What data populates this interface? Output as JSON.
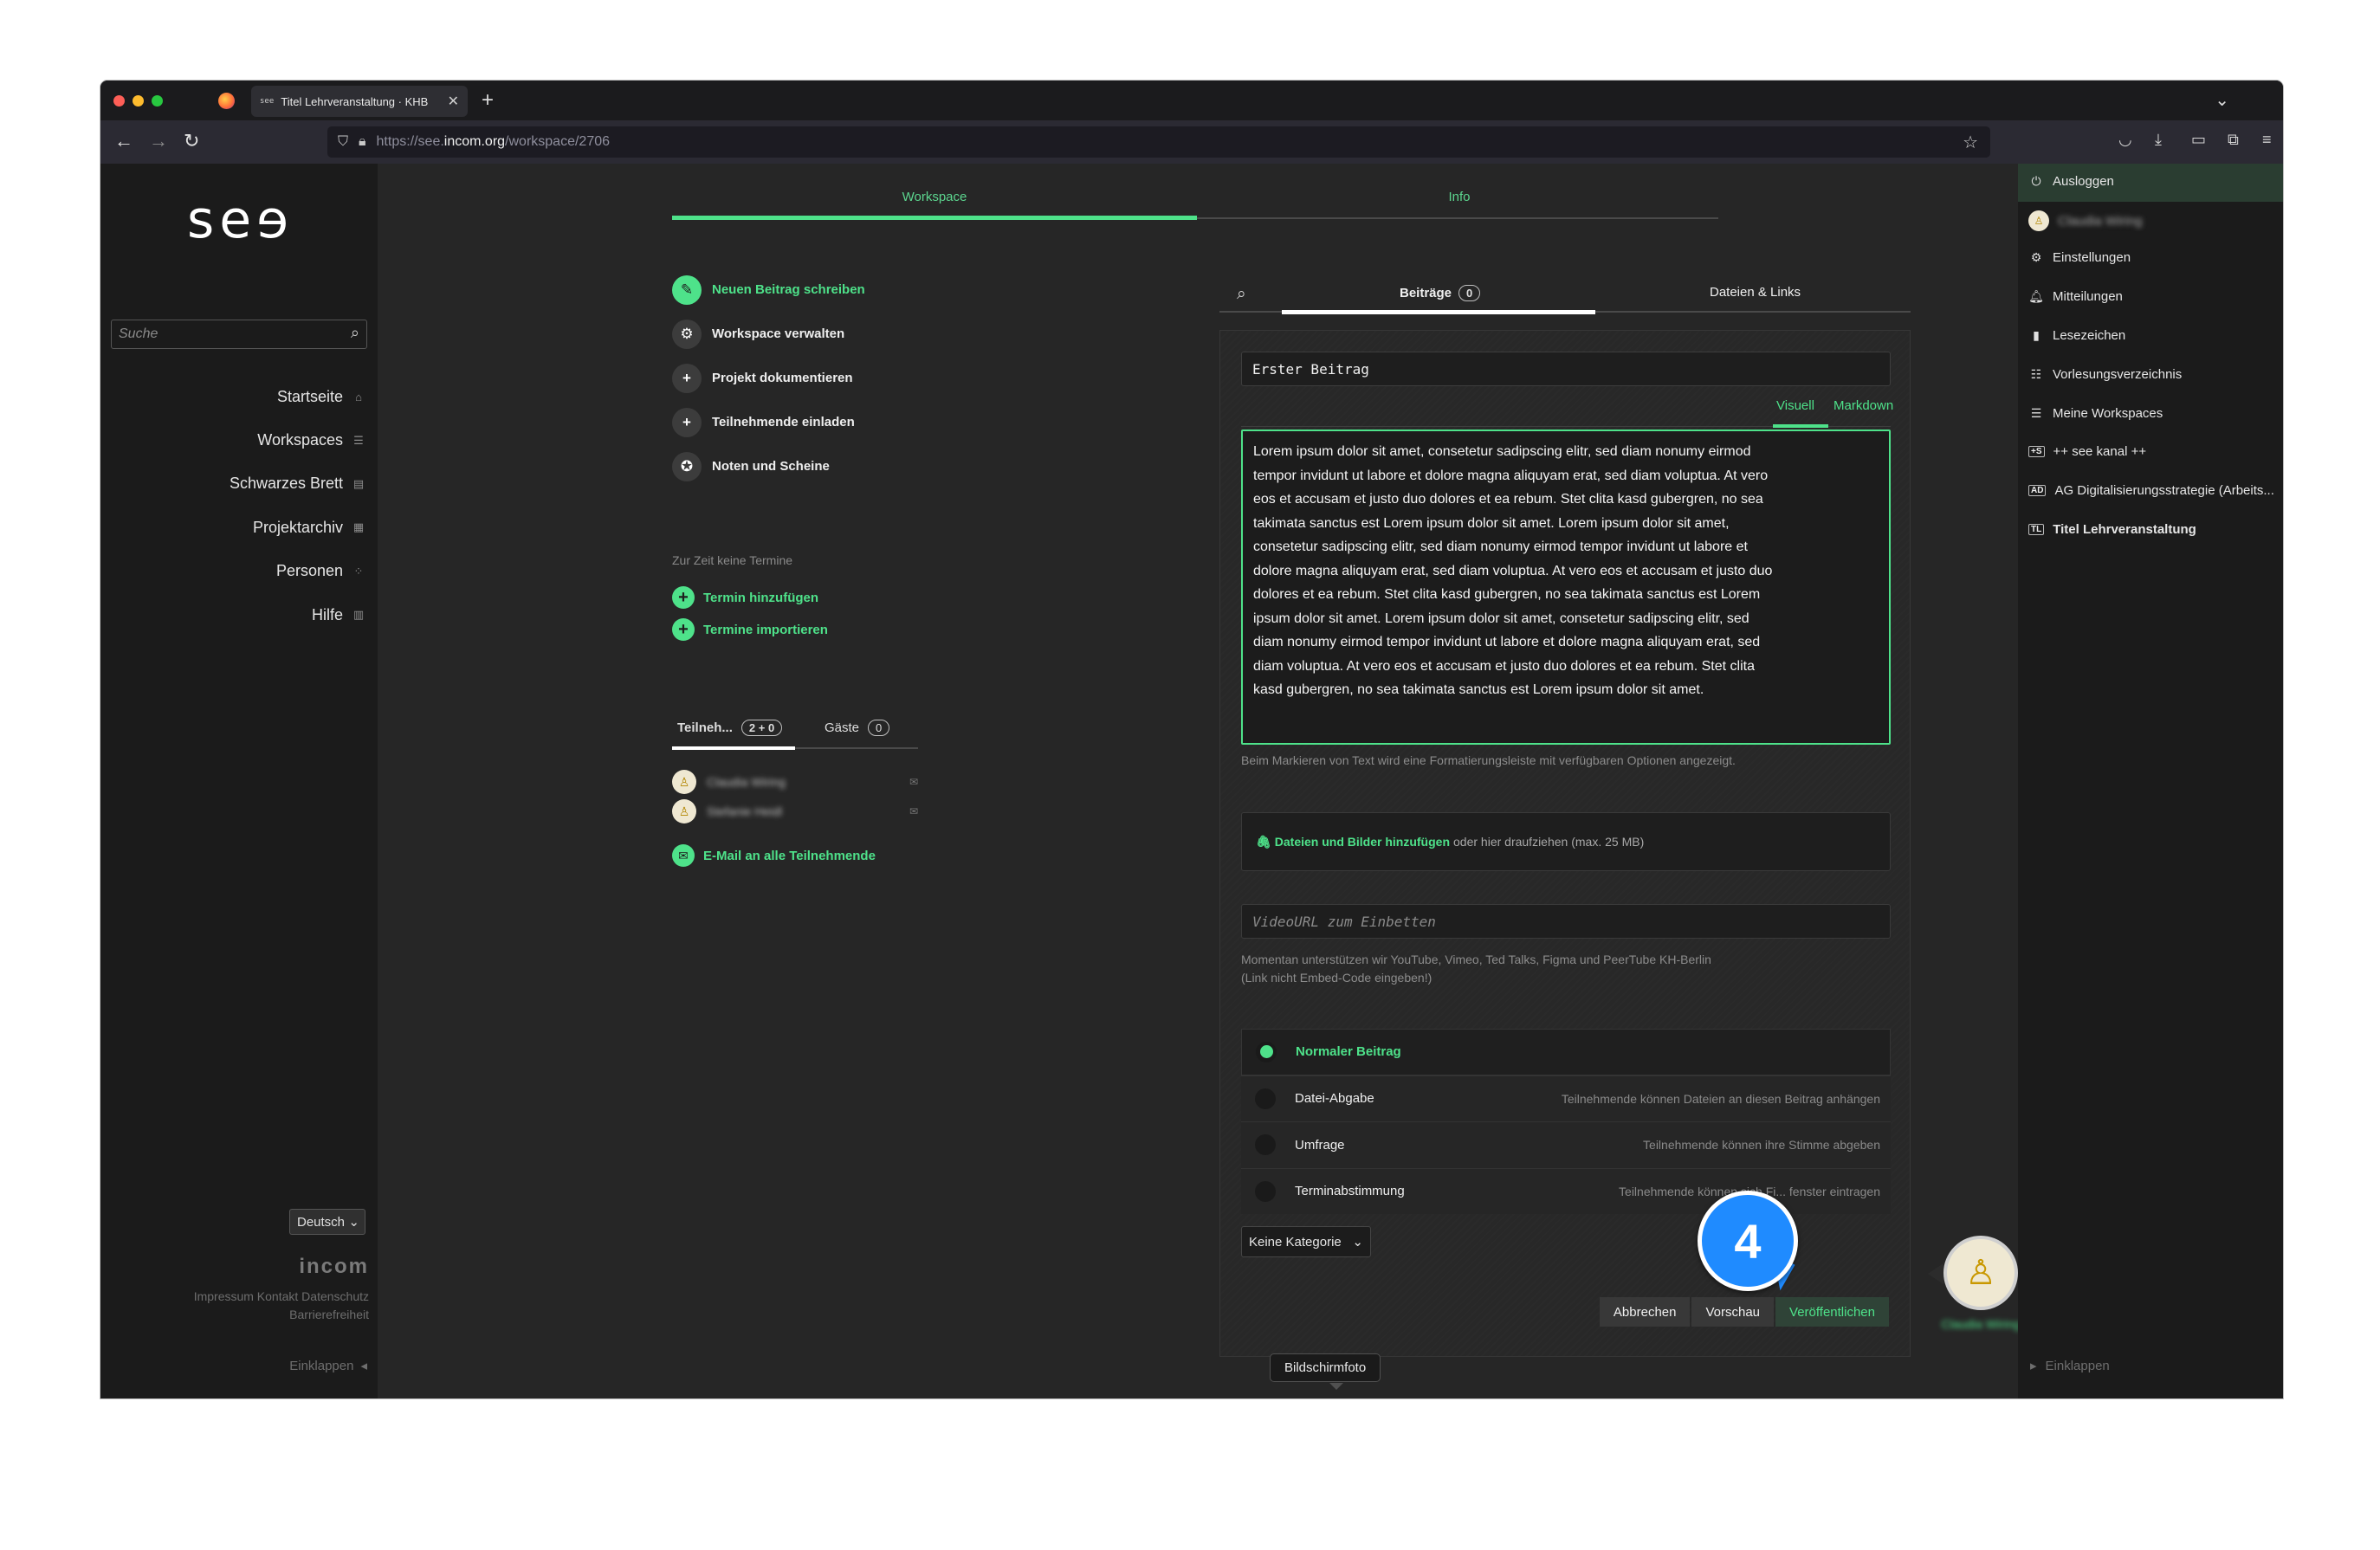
{
  "browser": {
    "tab_favicon": "see",
    "tab_title": "Titel Lehrveranstaltung · KHB",
    "url_prefix": "https://see.",
    "url_host": "incom.org",
    "url_path": "/workspace/2706"
  },
  "leftbar": {
    "logo": "seɘ",
    "search_placeholder": "Suche",
    "nav": [
      {
        "label": "Startseite",
        "icon": "home-icon"
      },
      {
        "label": "Workspaces",
        "icon": "list-icon"
      },
      {
        "label": "Schwarzes Brett",
        "icon": "board-icon"
      },
      {
        "label": "Projektarchiv",
        "icon": "grid-icon"
      },
      {
        "label": "Personen",
        "icon": "people-icon"
      },
      {
        "label": "Hilfe",
        "icon": "book-icon"
      }
    ],
    "language": "Deutsch",
    "incom_logo": "incom",
    "footer_line1": "Impressum Kontakt Datenschutz",
    "footer_line2": "Barrierefreiheit",
    "collapse": "Einklappen"
  },
  "main": {
    "tabs": [
      "Workspace",
      "Info"
    ],
    "actions": [
      {
        "label": "Neuen Beitrag schreiben",
        "icon": "pencil-icon"
      },
      {
        "label": "Workspace verwalten",
        "icon": "gear-icon"
      },
      {
        "label": "Projekt dokumentieren",
        "icon": "plus-icon"
      },
      {
        "label": "Teilnehmende einladen",
        "icon": "plus-icon"
      },
      {
        "label": "Noten und Scheine",
        "icon": "badge-icon"
      }
    ],
    "no_events": "Zur Zeit keine Termine",
    "add_event": "Termin hinzufügen",
    "import_events": "Termine importieren",
    "participants_tab": "Teilneh...",
    "participants_count": "2 + 0",
    "guests_tab": "Gäste",
    "guests_count": "0",
    "members": [
      "Claudia Wiring",
      "Stefanie Heidl"
    ],
    "email_all": "E-Mail an alle Teilnehmende"
  },
  "editor": {
    "tab_posts": "Beiträge",
    "posts_count": "0",
    "tab_files": "Dateien & Links",
    "title_value": "Erster Beitrag",
    "mode_visual": "Visuell",
    "mode_markdown": "Markdown",
    "body_text": "Lorem ipsum dolor sit amet, consetetur sadipscing elitr, sed diam nonumy eirmod tempor invidunt ut labore et dolore magna aliquyam erat, sed diam voluptua. At vero eos et accusam et justo duo dolores et ea rebum. Stet clita kasd gubergren, no sea takimata sanctus est Lorem ipsum dolor sit amet. Lorem ipsum dolor sit amet, consetetur sadipscing elitr, sed diam nonumy eirmod tempor invidunt ut labore et dolore magna ali­quyam erat, sed diam voluptua. At vero eos et accusam et justo duo dolo­res et ea rebum. Stet clita kasd gubergren, no sea takimata sanctus est Lorem ipsum dolor sit amet. Lorem ipsum dolor sit amet, consetetur sa­dipscing elitr, sed diam nonumy eirmod tempor invidunt ut labore et do­lore magna aliquyam erat, sed diam voluptua. At vero eos et accusam et justo duo dolores et ea rebum. Stet clita kasd gubergren, no sea takimata sanctus est Lorem ipsum dolor sit amet.",
    "format_hint": "Beim Markieren von Text wird eine Formatierungsleiste mit verfügbaren Optionen angezeigt.",
    "upload_link": "Dateien und Bilder hinzufügen",
    "upload_rest": "oder hier draufziehen (max. 25 MB)",
    "video_placeholder": "VideoURL zum Einbetten",
    "video_note_1": "Momentan unterstützen wir YouTube, Vimeo, Ted Talks, Figma und PeerTube KH-Berlin",
    "video_note_2": "(Link nicht Embed-Code eingeben!)",
    "post_types": [
      {
        "label": "Normaler Beitrag",
        "desc": "",
        "selected": true
      },
      {
        "label": "Datei-Abgabe",
        "desc": "Teilnehmende können Dateien an diesen Beitrag anhängen",
        "selected": false
      },
      {
        "label": "Umfrage",
        "desc": "Teilnehmende können ihre Stimme abgeben",
        "selected": false
      },
      {
        "label": "Terminabstimmung",
        "desc": "Teilnehmende können sich Fi... fenster eintragen",
        "selected": false
      }
    ],
    "category": "Keine Kategorie",
    "cancel": "Abbrechen",
    "preview": "Vorschau",
    "publish": "Veröffentlichen",
    "author_name": "Claudia Wiring"
  },
  "tooltip": "Bildschirmfoto",
  "step_marker": "4",
  "rightbar": {
    "logout": "Ausloggen",
    "user": "Claudia Wiring",
    "items": [
      {
        "label": "Einstellungen",
        "icon": "gear-icon"
      },
      {
        "label": "Mitteilungen",
        "icon": "bell-icon"
      },
      {
        "label": "Lesezeichen",
        "icon": "bookmark-icon"
      },
      {
        "label": "Vorlesungsverzeichnis",
        "icon": "catalog-icon"
      },
      {
        "label": "Meine Workspaces",
        "icon": "list-icon"
      },
      {
        "label": "++ see kanal ++",
        "badge": "+S"
      },
      {
        "label": "AG Digitalisierungsstrategie (Arbeits...",
        "badge": "AD"
      },
      {
        "label": "Titel Lehrveranstaltung",
        "badge": "TL"
      }
    ],
    "collapse": "Einklappen"
  }
}
